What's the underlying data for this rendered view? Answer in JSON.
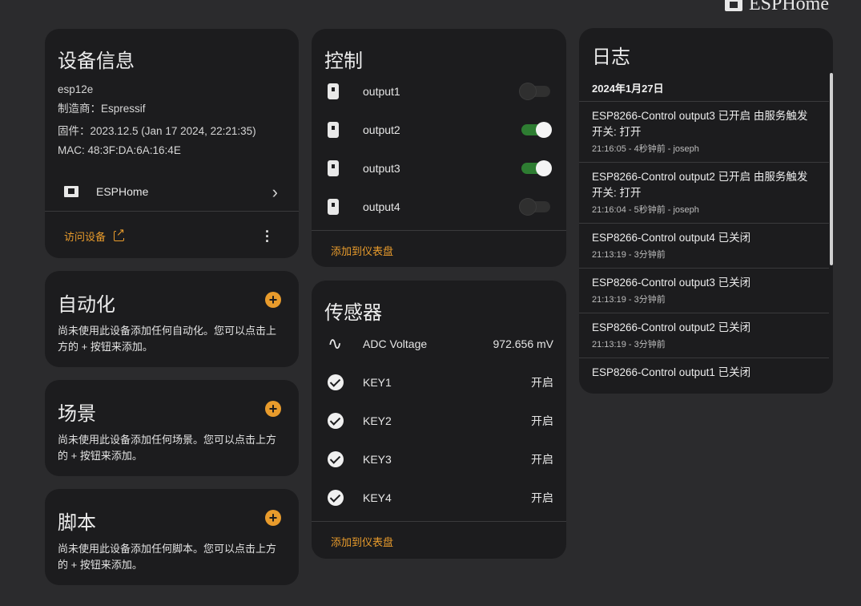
{
  "header": {
    "brand": "ESPHome"
  },
  "device": {
    "title": "设备信息",
    "model": "esp12e",
    "manufacturer": "制造商：Espressif",
    "firmware": "固件：2023.12.5 (Jan 17 2024, 22:21:35)",
    "mac": "MAC: 48:3F:DA:6A:16:4E",
    "integration": "ESPHome",
    "visit_label": "访问设备"
  },
  "automation": {
    "title": "自动化",
    "desc": "尚未使用此设备添加任何自动化。您可以点击上方的 + 按钮来添加。"
  },
  "scenes": {
    "title": "场景",
    "desc": "尚未使用此设备添加任何场景。您可以点击上方的 + 按钮来添加。"
  },
  "scripts": {
    "title": "脚本",
    "desc": "尚未使用此设备添加任何脚本。您可以点击上方的 + 按钮来添加。"
  },
  "control": {
    "title": "控制",
    "items": [
      {
        "label": "output1",
        "state": "off"
      },
      {
        "label": "output2",
        "state": "on"
      },
      {
        "label": "output3",
        "state": "on"
      },
      {
        "label": "output4",
        "state": "off"
      }
    ],
    "add_label": "添加到仪表盘"
  },
  "sensors": {
    "title": "传感器",
    "items": [
      {
        "label": "ADC Voltage",
        "value": "972.656 mV",
        "icon": "sine-wave-icon"
      },
      {
        "label": "KEY1",
        "value": "开启",
        "icon": "check-circle-icon"
      },
      {
        "label": "KEY2",
        "value": "开启",
        "icon": "check-circle-icon"
      },
      {
        "label": "KEY3",
        "value": "开启",
        "icon": "check-circle-icon"
      },
      {
        "label": "KEY4",
        "value": "开启",
        "icon": "check-circle-icon"
      }
    ],
    "add_label": "添加到仪表盘"
  },
  "log": {
    "title": "日志",
    "date": "2024年1月27日",
    "entries": [
      {
        "msg": "ESP8266-Control output3 已开启 由服务触发 开关: 打开",
        "meta": "21:16:05 - 4秒钟前 - joseph"
      },
      {
        "msg": "ESP8266-Control output2 已开启 由服务触发 开关: 打开",
        "meta": "21:16:04 - 5秒钟前 - joseph"
      },
      {
        "msg": "ESP8266-Control output4 已关闭",
        "meta": "21:13:19 - 3分钟前"
      },
      {
        "msg": "ESP8266-Control output3 已关闭",
        "meta": "21:13:19 - 3分钟前"
      },
      {
        "msg": "ESP8266-Control output2 已关闭",
        "meta": "21:13:19 - 3分钟前"
      },
      {
        "msg": "ESP8266-Control output1 已关闭",
        "meta": ""
      }
    ]
  },
  "colors": {
    "accent": "#e89b2c",
    "toggle_on": "#2e7d32",
    "card_bg": "#1c1c1e",
    "page_bg": "#2b2b2d"
  }
}
